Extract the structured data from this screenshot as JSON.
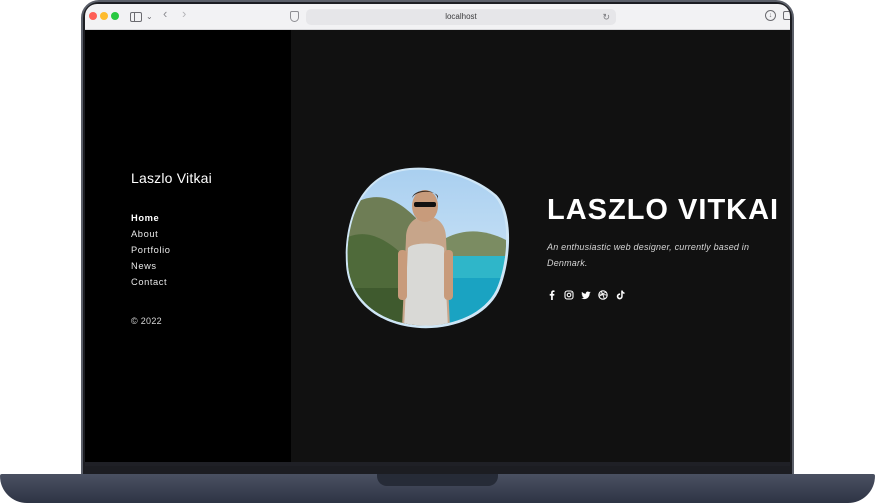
{
  "browser": {
    "url": "localhost"
  },
  "site": {
    "brand": "Laszlo Vitkai",
    "nav": [
      {
        "label": "Home",
        "active": true
      },
      {
        "label": "About",
        "active": false
      },
      {
        "label": "Portfolio",
        "active": false
      },
      {
        "label": "News",
        "active": false
      },
      {
        "label": "Contact",
        "active": false
      }
    ],
    "copyright": "© 2022"
  },
  "hero": {
    "name": "LASZLO VITKAI",
    "tagline": "An enthusiastic web designer, currently based in Denmark.",
    "socials": [
      "facebook-icon",
      "instagram-icon",
      "twitter-icon",
      "dribbble-icon",
      "tiktok-icon"
    ]
  },
  "colors": {
    "sidebar_bg": "#000000",
    "main_bg": "#111111",
    "text": "#ffffff"
  }
}
